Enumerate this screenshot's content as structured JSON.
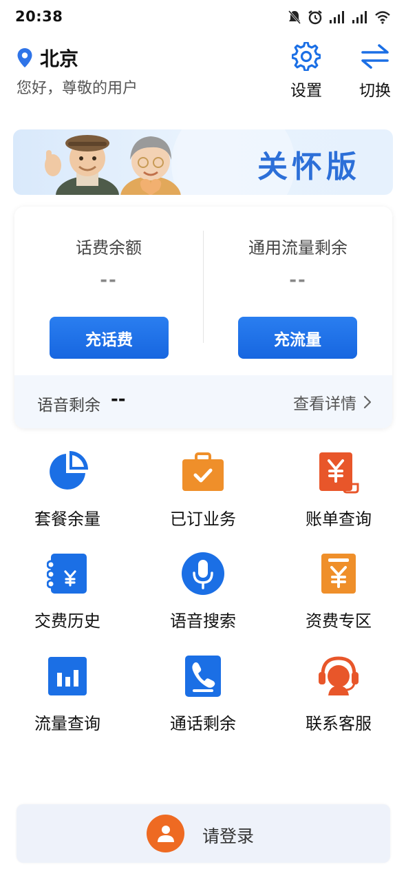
{
  "status_bar": {
    "time": "20:38",
    "icons": [
      "mute-icon",
      "alarm-icon",
      "signal-icon",
      "signal-icon",
      "wifi-icon"
    ]
  },
  "header": {
    "location_icon": "location-pin-icon",
    "city": "北京",
    "greeting": "您好，尊敬的用户",
    "settings_label": "设置",
    "switch_label": "切换"
  },
  "banner": {
    "title": "关怀版"
  },
  "balance": {
    "phone_fee": {
      "label": "话费余额",
      "value": "--",
      "button": "充话费"
    },
    "data": {
      "label": "通用流量剩余",
      "value": "--",
      "button": "充流量"
    },
    "voice": {
      "label": "语音剩余",
      "value": "--"
    },
    "details_link": "查看详情"
  },
  "grid": [
    {
      "label": "套餐余量",
      "icon": "pie-chart-icon"
    },
    {
      "label": "已订业务",
      "icon": "briefcase-check-icon"
    },
    {
      "label": "账单查询",
      "icon": "bill-icon"
    },
    {
      "label": "交费历史",
      "icon": "payment-notebook-icon"
    },
    {
      "label": "语音搜索",
      "icon": "microphone-icon"
    },
    {
      "label": "资费专区",
      "icon": "price-tag-icon"
    },
    {
      "label": "流量查询",
      "icon": "bar-chart-icon"
    },
    {
      "label": "通话剩余",
      "icon": "phone-icon"
    },
    {
      "label": "联系客服",
      "icon": "headset-agent-icon"
    }
  ],
  "login": {
    "label": "请登录",
    "icon": "user-avatar-icon"
  },
  "colors": {
    "primary_blue": "#1b6fe5",
    "accent_orange": "#ef8f2a",
    "accent_red_orange": "#e8562a"
  }
}
